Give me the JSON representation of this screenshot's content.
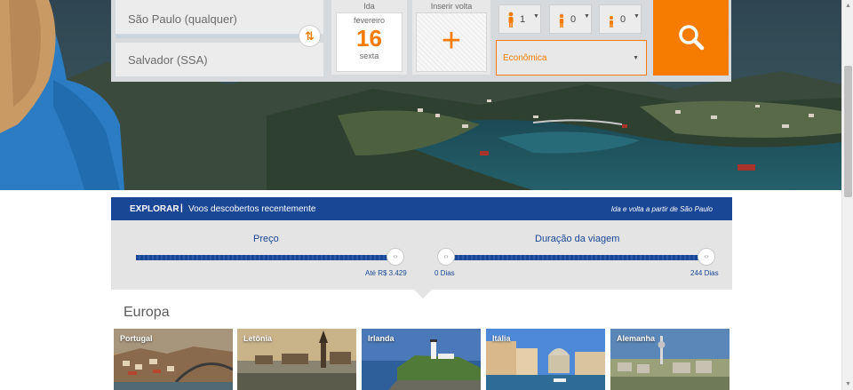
{
  "search": {
    "origin": "São Paulo (qualquer)",
    "destination": "Salvador (SSA)",
    "departure": {
      "label": "Ida",
      "month": "fevereiro",
      "day": "16",
      "weekday": "sexta"
    },
    "return": {
      "label": "Inserir volta",
      "symbol": "+"
    },
    "passengers": [
      {
        "type": "adult",
        "icon": "person-icon",
        "value": "1"
      },
      {
        "type": "child",
        "icon": "child-icon",
        "value": "0"
      },
      {
        "type": "infant",
        "icon": "infant-icon",
        "value": "0"
      }
    ],
    "cabin_class": "Econômica",
    "accent_color": "#f57c00"
  },
  "explore": {
    "title": "EXPLORAR",
    "separator": "|",
    "subtitle": "Voos descobertos recentemente",
    "right_note": "Ida e volta a partir de São Paulo",
    "bar_color": "#1a4696"
  },
  "filters": {
    "price": {
      "title": "Preço",
      "max_label": "Até R$ 3.429"
    },
    "duration": {
      "title": "Duração da viagem",
      "min_label": "0 Dias",
      "max_label": "244 Dias"
    }
  },
  "section": {
    "title": "Europa",
    "destinations": [
      {
        "name": "Portugal"
      },
      {
        "name": "Letônia"
      },
      {
        "name": "Irlanda"
      },
      {
        "name": "Itália"
      },
      {
        "name": "Alemanha"
      }
    ]
  }
}
